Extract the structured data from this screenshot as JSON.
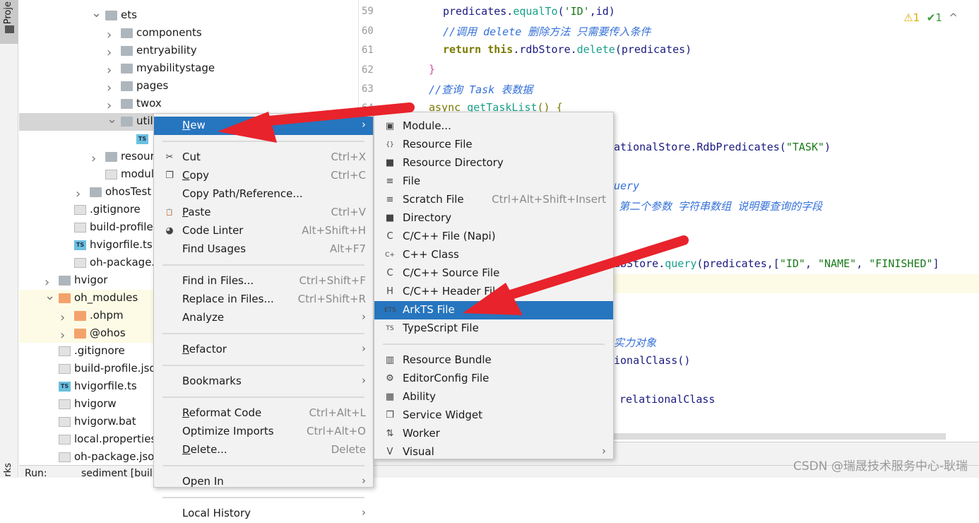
{
  "sidebar": {
    "project_tab": "Proje",
    "bookmarks_tab": "rks"
  },
  "tree": [
    {
      "label": "ets",
      "depth": 0,
      "chev": "down",
      "icon": "folder"
    },
    {
      "label": "components",
      "depth": 1,
      "chev": "right",
      "icon": "folder"
    },
    {
      "label": "entryability",
      "depth": 1,
      "chev": "right",
      "icon": "folder"
    },
    {
      "label": "myabilitystage",
      "depth": 1,
      "chev": "right",
      "icon": "folder"
    },
    {
      "label": "pages",
      "depth": 1,
      "chev": "right",
      "icon": "folder"
    },
    {
      "label": "twox",
      "depth": 1,
      "chev": "right",
      "icon": "folder"
    },
    {
      "label": "util",
      "depth": 1,
      "chev": "down",
      "icon": "folder",
      "selected": true
    },
    {
      "label": "",
      "depth": 2,
      "icon": "ts"
    },
    {
      "label": "resour",
      "depth": 0,
      "chev": "right",
      "icon": "folder"
    },
    {
      "label": "modul",
      "depth": 0,
      "icon": "json"
    },
    {
      "label": "ohosTest",
      "depth": -1,
      "chev": "right",
      "icon": "folder"
    },
    {
      "label": ".gitignore",
      "depth": -2,
      "icon": "file"
    },
    {
      "label": "build-profile",
      "depth": -2,
      "icon": "json"
    },
    {
      "label": "hvigorfile.ts",
      "depth": -2,
      "icon": "ts"
    },
    {
      "label": "oh-package.",
      "depth": -2,
      "icon": "json"
    },
    {
      "label": "hvigor",
      "depth": -3,
      "chev": "right",
      "icon": "folder"
    },
    {
      "label": "oh_modules",
      "depth": -3,
      "chev": "down",
      "icon": "folder-orange",
      "highlight": true
    },
    {
      "label": ".ohpm",
      "depth": -2,
      "chev": "right",
      "icon": "folder-orange",
      "highlight": true
    },
    {
      "label": "@ohos",
      "depth": -2,
      "chev": "right",
      "icon": "folder-orange",
      "highlight": true
    },
    {
      "label": ".gitignore",
      "depth": -3,
      "icon": "file"
    },
    {
      "label": "build-profile.jso",
      "depth": -3,
      "icon": "json"
    },
    {
      "label": "hvigorfile.ts",
      "depth": -3,
      "icon": "ts"
    },
    {
      "label": "hvigorw",
      "depth": -3,
      "icon": "file"
    },
    {
      "label": "hvigorw.bat",
      "depth": -3,
      "icon": "file"
    },
    {
      "label": "local.properties",
      "depth": -3,
      "icon": "file"
    },
    {
      "label": "oh-package.jso",
      "depth": -3,
      "icon": "json"
    }
  ],
  "editor": {
    "line_numbers": [
      "59",
      "60",
      "61",
      "62",
      "63",
      "64"
    ],
    "status": {
      "warnings": "⚠1",
      "checks": "✔1",
      "expand": "^"
    },
    "watermark": "CSDN @瑞晟技术服务中心-耿瑞"
  },
  "bottom": {
    "run_label": "Run:",
    "run_config": "sediment [buil"
  },
  "context_menu": [
    {
      "label": "New",
      "arrow": true,
      "selected": true,
      "u": 0
    },
    {
      "sep": true
    },
    {
      "label": "Cut",
      "shortcut": "Ctrl+X",
      "icon": "scissors-icon",
      "glyph": "✂",
      "u": 2
    },
    {
      "label": "Copy",
      "shortcut": "Ctrl+C",
      "icon": "copy-icon",
      "glyph": "❐",
      "u": 0
    },
    {
      "label": "Copy Path/Reference..."
    },
    {
      "label": "Paste",
      "shortcut": "Ctrl+V",
      "icon": "paste-icon",
      "glyph": "📋",
      "u": 0
    },
    {
      "label": "Code Linter",
      "shortcut": "Alt+Shift+H",
      "icon": "linter-icon",
      "glyph": "◕"
    },
    {
      "label": "Find Usages",
      "shortcut": "Alt+F7"
    },
    {
      "sep": true
    },
    {
      "label": "Find in Files...",
      "shortcut": "Ctrl+Shift+F"
    },
    {
      "label": "Replace in Files...",
      "shortcut": "Ctrl+Shift+R",
      "u": 5
    },
    {
      "label": "Analyze",
      "arrow": true,
      "u": 5
    },
    {
      "sep": true
    },
    {
      "label": "Refactor",
      "arrow": true,
      "u": 0
    },
    {
      "sep": true
    },
    {
      "label": "Bookmarks",
      "arrow": true
    },
    {
      "sep": true
    },
    {
      "label": "Reformat Code",
      "shortcut": "Ctrl+Alt+L",
      "u": 0
    },
    {
      "label": "Optimize Imports",
      "shortcut": "Ctrl+Alt+O",
      "u": 6
    },
    {
      "label": "Delete...",
      "shortcut": "Delete",
      "u": 0
    },
    {
      "sep": true
    },
    {
      "label": "Open In",
      "arrow": true
    },
    {
      "sep": true
    },
    {
      "label": "Local History",
      "arrow": true
    }
  ],
  "new_submenu": [
    {
      "label": "Module...",
      "icon": "module-icon",
      "glyph": "▣"
    },
    {
      "label": "Resource File",
      "icon": "resource-file-icon",
      "glyph": "{}"
    },
    {
      "label": "Resource Directory",
      "icon": "folder-icon",
      "glyph": "■"
    },
    {
      "label": "File",
      "icon": "file-icon",
      "glyph": "≡"
    },
    {
      "label": "Scratch File",
      "shortcut": "Ctrl+Alt+Shift+Insert",
      "icon": "scratch-file-icon",
      "glyph": "≡"
    },
    {
      "label": "Directory",
      "icon": "folder-icon",
      "glyph": "■"
    },
    {
      "label": "C/C++ File (Napi)",
      "icon": "c-file-icon",
      "glyph": "C"
    },
    {
      "label": "C++ Class",
      "icon": "cpp-class-icon",
      "glyph": "C+"
    },
    {
      "label": "C/C++ Source File",
      "icon": "c-source-icon",
      "glyph": "C"
    },
    {
      "label": "C/C++ Header File",
      "icon": "c-header-icon",
      "glyph": "H"
    },
    {
      "label": "ArkTS File",
      "icon": "arkts-file-icon",
      "glyph": "ETS",
      "selected": true
    },
    {
      "label": "TypeScript File",
      "icon": "ts-file-icon",
      "glyph": "TS"
    },
    {
      "sep": true
    },
    {
      "label": "Resource Bundle",
      "icon": "resource-bundle-icon",
      "glyph": "▥"
    },
    {
      "label": "EditorConfig File",
      "icon": "gear-icon",
      "glyph": "⚙"
    },
    {
      "label": "Ability",
      "icon": "ability-icon",
      "glyph": "▦"
    },
    {
      "label": "Service Widget",
      "icon": "widget-icon",
      "glyph": "❐"
    },
    {
      "label": "Worker",
      "icon": "worker-icon",
      "glyph": "⇅"
    },
    {
      "label": "Visual",
      "icon": "visual-icon",
      "glyph": "V",
      "arrow": true
    }
  ],
  "colors": {
    "selection": "#2675bf",
    "arrow": "#e8232b",
    "highlight_row": "#fdfbe6"
  }
}
